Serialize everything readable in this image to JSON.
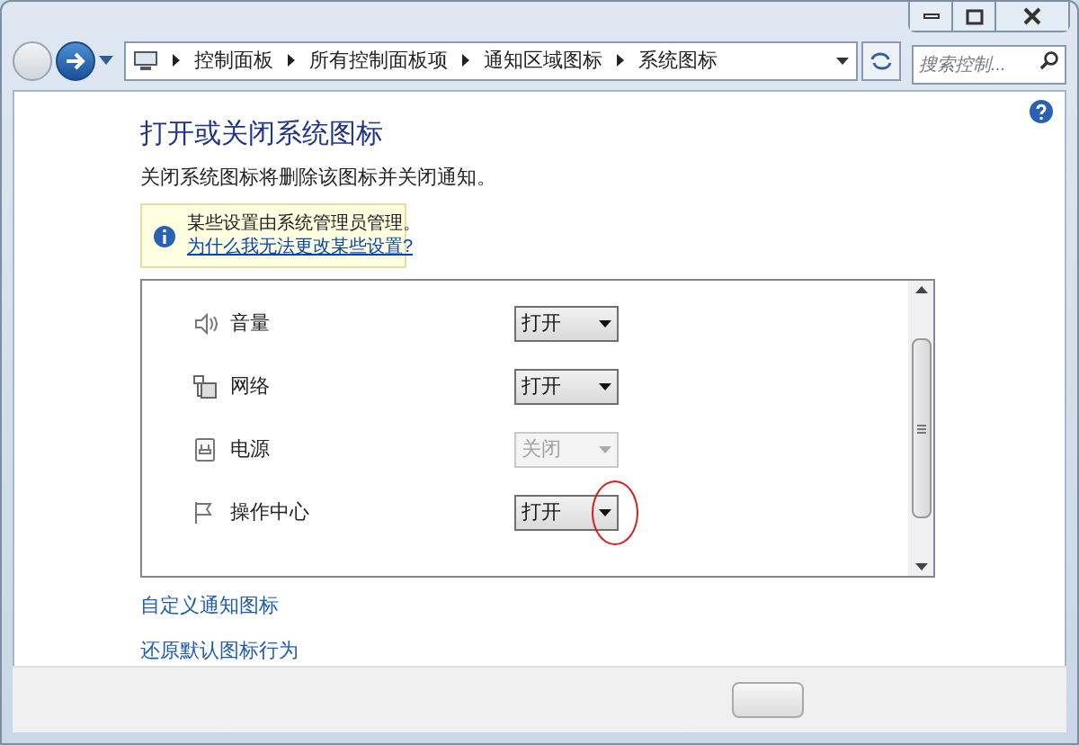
{
  "address_bar": {
    "breadcrumbs": [
      "控制面板",
      "所有控制面板项",
      "通知区域图标",
      "系统图标"
    ],
    "search": {
      "placeholder": "搜索控制..."
    }
  },
  "heading": "打开或关闭系统图标",
  "description": "关闭系统图标将删除该图标并关闭通知。",
  "notice": {
    "message": "某些设置由系统管理员管理。",
    "link": "为什么我无法更改某些设置?"
  },
  "icons": [
    {
      "kind": "volume",
      "name": "音量",
      "value": "打开",
      "disabled": false,
      "highlighted": false
    },
    {
      "kind": "network",
      "name": "网络",
      "value": "打开",
      "disabled": false,
      "highlighted": false
    },
    {
      "kind": "power",
      "name": "电源",
      "value": "关闭",
      "disabled": true,
      "highlighted": false
    },
    {
      "kind": "flag",
      "name": "操作中心",
      "value": "打开",
      "disabled": false,
      "highlighted": true
    }
  ],
  "links": [
    "自定义通知图标",
    "还原默认图标行为"
  ]
}
